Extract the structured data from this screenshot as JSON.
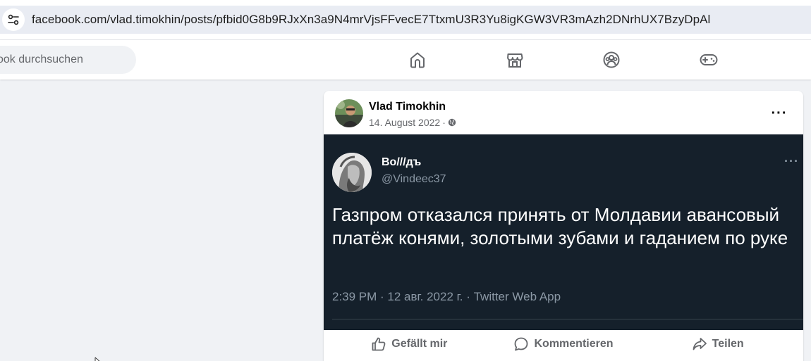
{
  "browser": {
    "url": "facebook.com/vlad.timokhin/posts/pfbid0G8b9RJxXn3a9N4mrVjsFFvecE7TtxmU3R3Yu8igKGW3VR3mAzh2DNrhUX7BzyDpAl",
    "site_info_icon": "tune-icon"
  },
  "header": {
    "search_placeholder": "ook durchsuchen",
    "nav": [
      {
        "name": "home",
        "icon": "home-icon"
      },
      {
        "name": "marketplace",
        "icon": "store-icon"
      },
      {
        "name": "groups",
        "icon": "groups-icon"
      },
      {
        "name": "gaming",
        "icon": "gamepad-icon"
      }
    ]
  },
  "post": {
    "author": "Vlad Timokhin",
    "date": "14. August 2022",
    "separator": "·",
    "audience_icon": "globe-icon",
    "more_label": "···",
    "tweet": {
      "name": "Во///дъ",
      "handle": "@Vindeec37",
      "more_label": "···",
      "text": "Газпром отказался принять от Молдавии авансовый платёж конями, золотыми зубами и гаданием по руке",
      "meta": "2:39 PM · 12 авг. 2022 г. · Twitter Web App"
    },
    "actions": {
      "like": "Gefällt mir",
      "comment": "Kommentieren",
      "share": "Teilen"
    }
  },
  "colors": {
    "page_bg": "#f0f2f5",
    "tweet_bg": "#15202b",
    "secondary_text": "#65676b",
    "tweet_muted": "#8b98a5"
  }
}
